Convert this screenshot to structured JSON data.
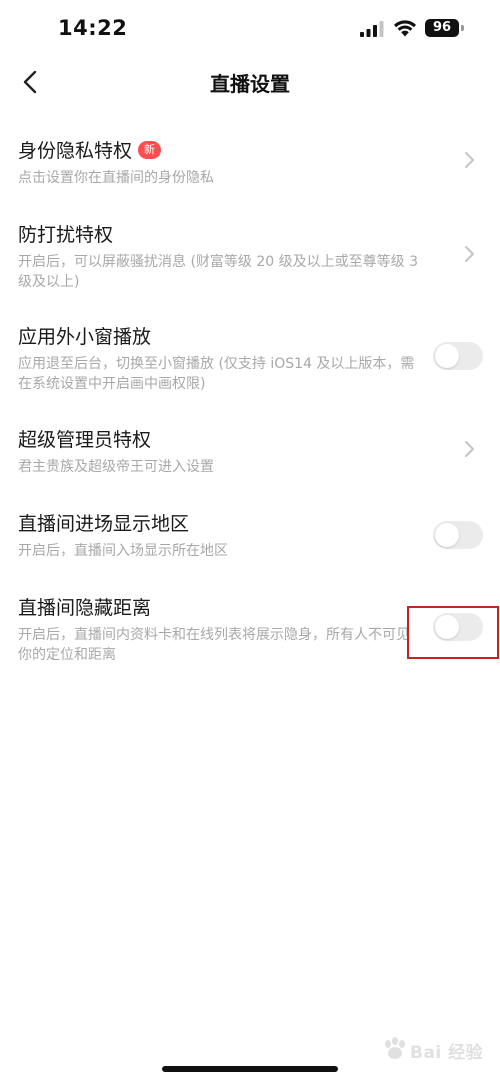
{
  "status_bar": {
    "time": "14:22",
    "battery": "96"
  },
  "nav": {
    "title": "直播设置"
  },
  "settings": [
    {
      "title": "身份隐私特权",
      "badge": "新",
      "desc": "点击设置你在直播间的身份隐私",
      "control": "chevron"
    },
    {
      "title": "防打扰特权",
      "desc": "开启后，可以屏蔽骚扰消息 (财富等级 20 级及以上或至尊等级 3 级及以上)",
      "control": "chevron"
    },
    {
      "title": "应用外小窗播放",
      "desc": "应用退至后台，切换至小窗播放 (仅支持 iOS14 及以上版本，需在系统设置中开启画中画权限)",
      "control": "toggle",
      "on": false
    },
    {
      "title": "超级管理员特权",
      "desc": "君主贵族及超级帝王可进入设置",
      "control": "chevron"
    },
    {
      "title": "直播间进场显示地区",
      "desc": "开启后，直播间入场显示所在地区",
      "control": "toggle",
      "on": false
    },
    {
      "title": "直播间隐藏距离",
      "desc": "开启后，直播间内资料卡和在线列表将展示隐身，所有人不可见你的定位和距离",
      "control": "toggle",
      "on": false
    }
  ],
  "watermark": {
    "text": "Bai 经验"
  },
  "colors": {
    "badge": "#ff4d4f",
    "toggle_off": "#ebebeb",
    "desc_text": "#a8a8a8",
    "highlight": "#c8231e"
  }
}
